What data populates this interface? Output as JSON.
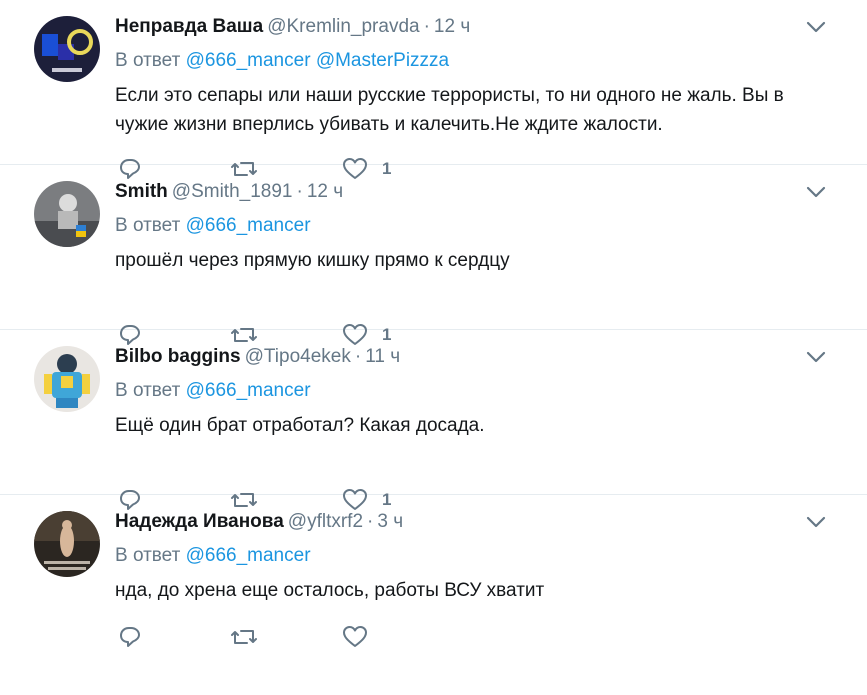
{
  "tweets": [
    {
      "name": "Неправда Ваша",
      "handle": "@Kremlin_pravda",
      "dot": "·",
      "time": "12 ч",
      "reply_prefix": "В ответ",
      "mentions": [
        "@666_mancer",
        "@MasterPizzza"
      ],
      "text": "Если это сепары или наши русские террористы, то ни одного не жаль. Вы в чужие жизни вперлись убивать и калечить.Не ждите жалости.",
      "likes": "1"
    },
    {
      "name": "Smith",
      "handle": "@Smith_1891",
      "dot": "·",
      "time": "12 ч",
      "reply_prefix": "В ответ",
      "mentions": [
        "@666_mancer"
      ],
      "text": "прошёл через прямую кишку прямо к сердцу",
      "likes": "1"
    },
    {
      "name": "Bilbo baggins",
      "handle": "@Tipo4ekek",
      "dot": "·",
      "time": "11 ч",
      "reply_prefix": "В ответ",
      "mentions": [
        "@666_mancer"
      ],
      "text": "Ещё один брат отработал? Какая досада.",
      "likes": "1"
    },
    {
      "name": "Надежда Иванова",
      "handle": "@yfltxrf2",
      "dot": "·",
      "time": "3 ч",
      "reply_prefix": "В ответ",
      "mentions": [
        "@666_mancer"
      ],
      "text": "нда, до хрена еще осталось, работы ВСУ хватит",
      "likes": ""
    }
  ],
  "icons": {
    "reply": "reply-icon",
    "retweet": "retweet-icon",
    "like": "like-icon",
    "more": "chevron-down-icon"
  },
  "colors": {
    "text": "#14171a",
    "muted": "#657786",
    "link": "#1b95e0",
    "divider": "#e6ecf0"
  }
}
